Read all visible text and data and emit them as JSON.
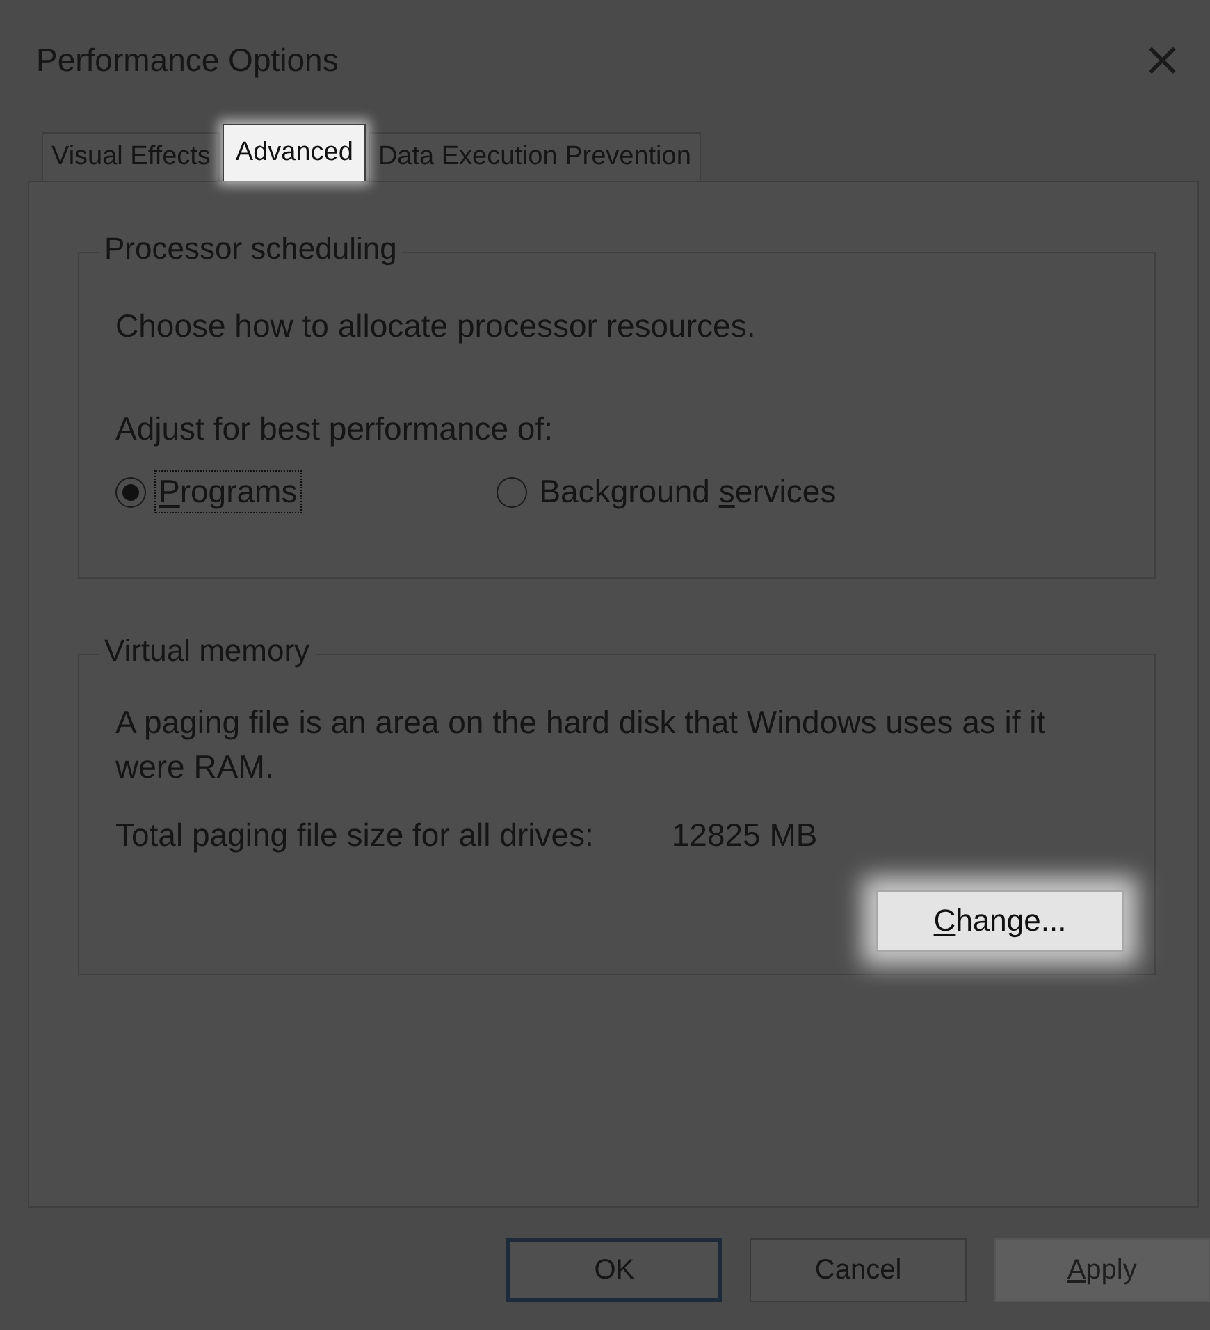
{
  "window": {
    "title": "Performance Options",
    "close": "×"
  },
  "tabs": [
    {
      "label": "Visual Effects",
      "selected": false,
      "highlighted": false
    },
    {
      "label": "Advanced",
      "selected": true,
      "highlighted": true
    },
    {
      "label": "Data Execution Prevention",
      "selected": false,
      "highlighted": false
    }
  ],
  "processor_scheduling": {
    "title": "Processor scheduling",
    "description": "Choose how to allocate processor resources.",
    "prompt": "Adjust for best performance of:",
    "options": [
      {
        "label": {
          "key": "P",
          "after": "rograms"
        },
        "selected": true,
        "focused": true
      },
      {
        "label": {
          "before": "Background ",
          "key": "s",
          "after": "ervices"
        },
        "selected": false,
        "focused": false
      }
    ]
  },
  "virtual_memory": {
    "title": "Virtual memory",
    "description": "A paging file is an area on the hard disk that Windows uses as if it were RAM.",
    "size_label": "Total paging file size for all drives:",
    "size_value": "12825 MB",
    "button": {
      "label": {
        "key": "C",
        "after": "hange..."
      },
      "highlighted": true
    }
  },
  "buttons": [
    {
      "label": {
        "before": "OK"
      },
      "default": true,
      "disabled": false
    },
    {
      "label": {
        "before": "Cancel"
      },
      "default": false,
      "disabled": false
    },
    {
      "label": {
        "key": "A",
        "after": "pply"
      },
      "default": false,
      "disabled": true
    }
  ]
}
